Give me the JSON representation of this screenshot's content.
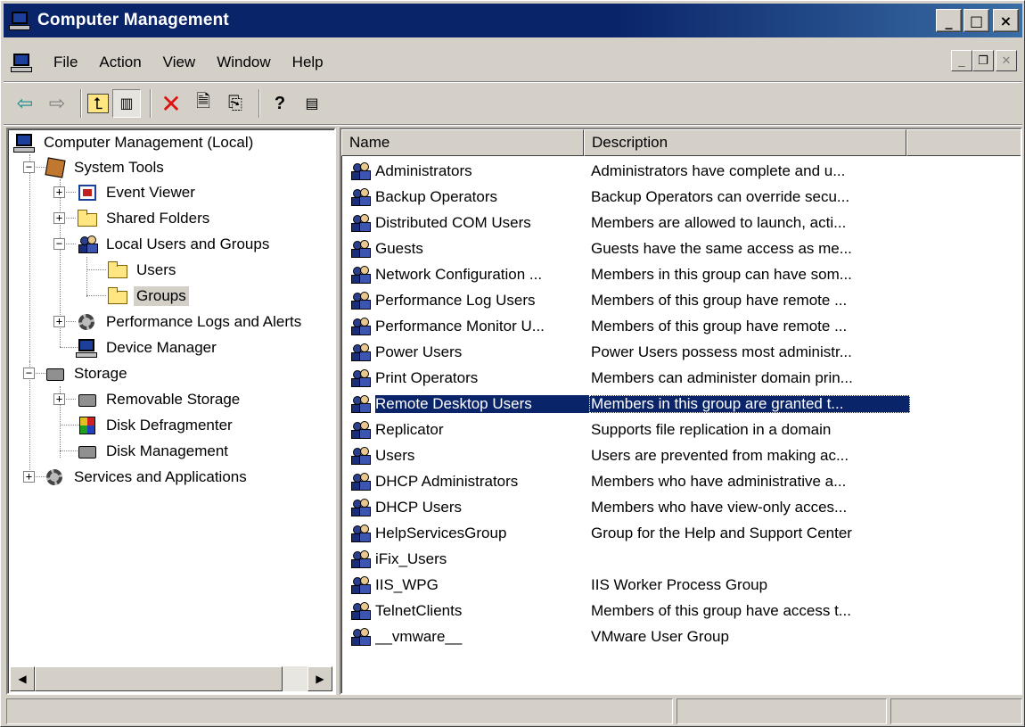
{
  "window": {
    "title": "Computer Management",
    "caption_buttons": [
      "_",
      "□",
      "×"
    ]
  },
  "menubar": {
    "items": [
      {
        "label": "File"
      },
      {
        "label": "Action"
      },
      {
        "label": "View"
      },
      {
        "label": "Window"
      },
      {
        "label": "Help"
      }
    ]
  },
  "toolbar": {
    "buttons": [
      "back-arrow-icon",
      "forward-arrow-icon",
      "up-level-icon",
      "show-hide-tree-icon",
      "delete-icon",
      "properties-icon",
      "export-list-icon",
      "help-icon",
      "action-pane-icon"
    ]
  },
  "tree": {
    "root": "Computer Management (Local)",
    "nodes": [
      {
        "label": "System Tools"
      },
      {
        "label": "Event Viewer"
      },
      {
        "label": "Shared Folders"
      },
      {
        "label": "Local Users and Groups"
      },
      {
        "label": "Users"
      },
      {
        "label": "Groups",
        "selected": true
      },
      {
        "label": "Performance Logs and Alerts"
      },
      {
        "label": "Device Manager"
      },
      {
        "label": "Storage"
      },
      {
        "label": "Removable Storage"
      },
      {
        "label": "Disk Defragmenter"
      },
      {
        "label": "Disk Management"
      },
      {
        "label": "Services and Applications"
      }
    ]
  },
  "list": {
    "columns": [
      "Name",
      "Description"
    ],
    "rows": [
      {
        "name": "Administrators",
        "description": "Administrators have complete and u..."
      },
      {
        "name": "Backup Operators",
        "description": "Backup Operators can override secu..."
      },
      {
        "name": "Distributed COM Users",
        "description": "Members are allowed to launch, acti..."
      },
      {
        "name": "Guests",
        "description": "Guests have the same access as me..."
      },
      {
        "name": "Network Configuration ...",
        "description": "Members in this group can have som..."
      },
      {
        "name": "Performance Log Users",
        "description": "Members of this group have remote ..."
      },
      {
        "name": "Performance Monitor U...",
        "description": "Members of this group have remote ..."
      },
      {
        "name": "Power Users",
        "description": "Power Users possess most administr..."
      },
      {
        "name": "Print Operators",
        "description": "Members can administer domain prin..."
      },
      {
        "name": "Remote Desktop Users",
        "description": "Members in this group are granted t...",
        "selected": true
      },
      {
        "name": "Replicator",
        "description": "Supports file replication in a domain"
      },
      {
        "name": "Users",
        "description": "Users are prevented from making ac..."
      },
      {
        "name": "DHCP Administrators",
        "description": "Members who have administrative a..."
      },
      {
        "name": "DHCP Users",
        "description": "Members who have view-only acces..."
      },
      {
        "name": "HelpServicesGroup",
        "description": "Group for the Help and Support Center"
      },
      {
        "name": "iFix_Users",
        "description": ""
      },
      {
        "name": "IIS_WPG",
        "description": "IIS Worker Process Group"
      },
      {
        "name": "TelnetClients",
        "description": "Members of this group have access t..."
      },
      {
        "name": "__vmware__",
        "description": "VMware User Group"
      }
    ]
  }
}
